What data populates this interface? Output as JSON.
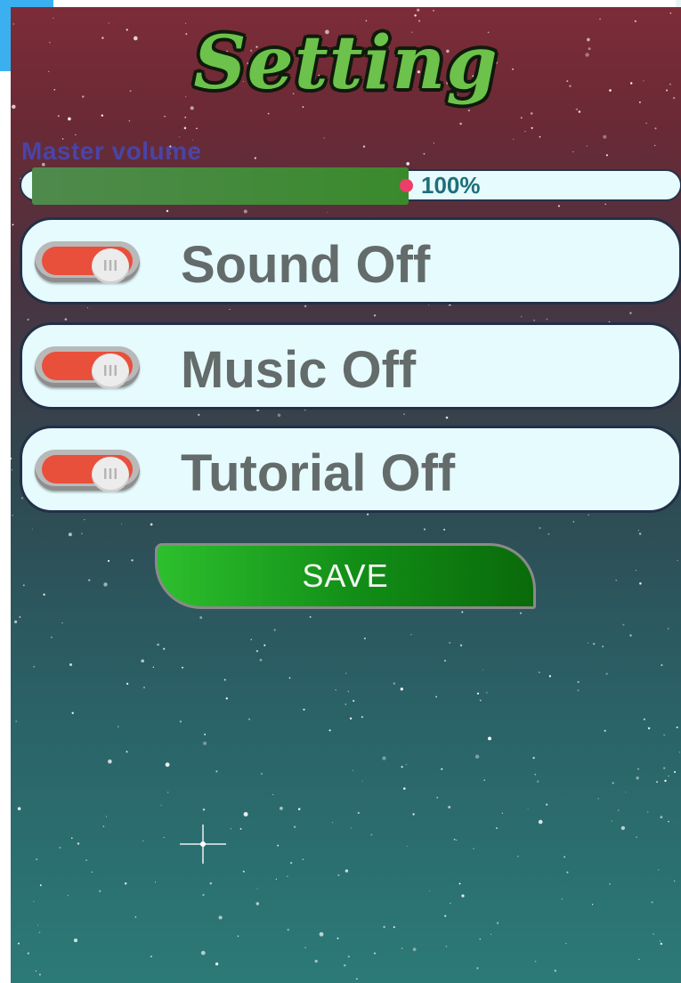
{
  "header": {
    "title": "Setting"
  },
  "volume": {
    "label": "Master volume",
    "value_text": "100%",
    "fill_fraction": 0.58
  },
  "toggles": [
    {
      "label": "Sound Off",
      "state": "off",
      "icon": "toggle-switch-icon"
    },
    {
      "label": "Music Off",
      "state": "off",
      "icon": "toggle-switch-icon"
    },
    {
      "label": "Tutorial Off",
      "state": "off",
      "icon": "toggle-switch-icon"
    }
  ],
  "save": {
    "label": "SAVE"
  },
  "colors": {
    "title_green": "#6cc24a",
    "toggle_red": "#e8503c",
    "save_green": "#118c16",
    "volume_fill": "#3a8a2c",
    "volume_thumb": "#ee3d6a",
    "label_blue": "#4a44a8"
  }
}
